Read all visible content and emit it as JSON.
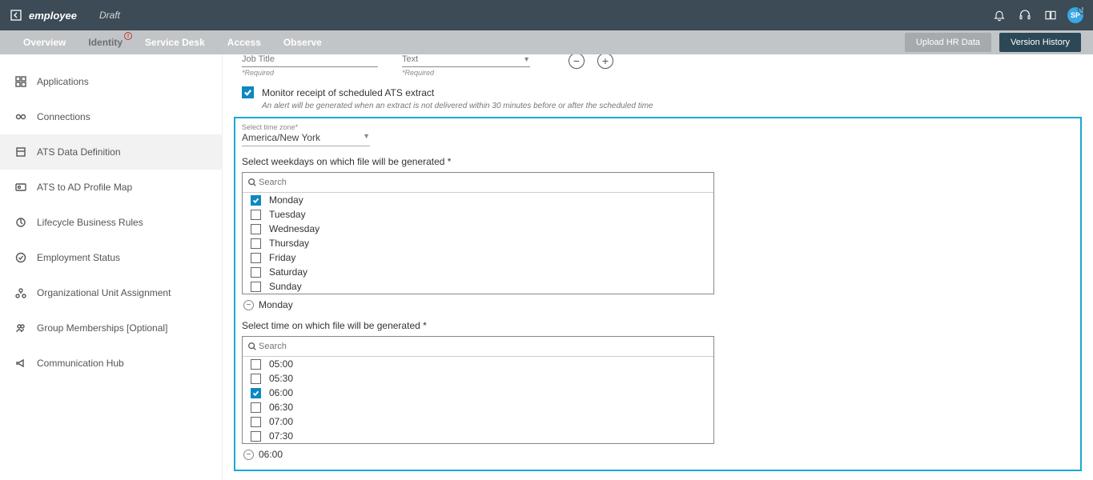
{
  "header": {
    "title": "employee",
    "status": "Draft",
    "avatar": "SP"
  },
  "tabs": {
    "overview": "Overview",
    "identity": "Identity",
    "service_desk": "Service Desk",
    "access": "Access",
    "observe": "Observe",
    "upload_btn": "Upload HR Data",
    "version_btn": "Version History"
  },
  "sidebar": {
    "applications": "Applications",
    "connections": "Connections",
    "ats_def": "ATS Data Definition",
    "ats_map": "ATS to AD Profile Map",
    "lifecycle": "Lifecycle Business Rules",
    "employment": "Employment Status",
    "org_unit": "Organizational Unit Assignment",
    "group_mem": "Group Memberships [Optional]",
    "comm_hub": "Communication Hub"
  },
  "form": {
    "job_title_label": "Job Title",
    "job_title_req": "*Required",
    "text_label": "Text",
    "text_req": "*Required",
    "monitor_label": "Monitor receipt of scheduled ATS extract",
    "monitor_hint": "An alert will be generated when an extract is not delivered within 30 minutes before or after the scheduled time",
    "tz_label": "Select time zone*",
    "tz_value": "America/New York",
    "weekdays_label": "Select weekdays on which file will be generated *",
    "search_placeholder": "Search",
    "days": {
      "mon": "Monday",
      "tue": "Tuesday",
      "wed": "Wednesday",
      "thu": "Thursday",
      "fri": "Friday",
      "sat": "Saturday",
      "sun": "Sunday"
    },
    "selected_day_chip": "Monday",
    "time_label": "Select time on which file will be generated *",
    "times": {
      "t0500": "05:00",
      "t0530": "05:30",
      "t0600": "06:00",
      "t0630": "06:30",
      "t0700": "07:00",
      "t0730": "07:30"
    },
    "selected_time_chip": "06:00"
  }
}
